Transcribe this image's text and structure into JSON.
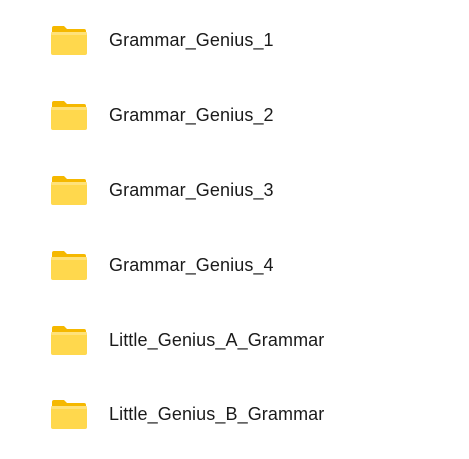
{
  "folders": [
    {
      "name": "Grammar_Genius_1",
      "icon": "folder-icon"
    },
    {
      "name": "Grammar_Genius_2",
      "icon": "folder-icon"
    },
    {
      "name": "Grammar_Genius_3",
      "icon": "folder-icon"
    },
    {
      "name": "Grammar_Genius_4",
      "icon": "folder-icon"
    },
    {
      "name": "Little_Genius_A_Grammar",
      "icon": "folder-icon"
    },
    {
      "name": "Little_Genius_B_Grammar",
      "icon": "folder-icon"
    }
  ],
  "colors": {
    "folder_back": "#F5B800",
    "folder_front": "#FFD84D",
    "folder_front_light": "#FFE27A",
    "text": "#1a1a1a"
  }
}
